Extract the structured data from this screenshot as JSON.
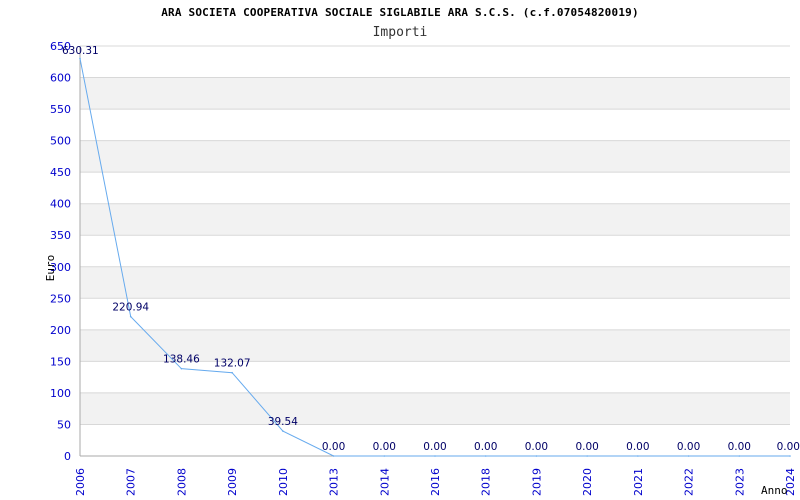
{
  "chart_data": {
    "type": "line",
    "title": "ARA SOCIETA COOPERATIVA SOCIALE SIGLABILE ARA S.C.S. (c.f.07054820019)",
    "subtitle": "Importi",
    "xlabel": "Anno",
    "ylabel": "Euro",
    "categories": [
      "2006",
      "2007",
      "2008",
      "2009",
      "2010",
      "2013",
      "2014",
      "2016",
      "2018",
      "2019",
      "2020",
      "2021",
      "2022",
      "2023",
      "2024"
    ],
    "series": [
      {
        "values": [
          630.31,
          220.94,
          138.46,
          132.07,
          39.54,
          0,
          0,
          0,
          0,
          0,
          0,
          0,
          0,
          0,
          0
        ]
      }
    ],
    "data_labels": [
      "630.31",
      "220.94",
      "138.46",
      "132.07",
      "39.54",
      "0.00",
      "0.00",
      "0.00",
      "0.00",
      "0.00",
      "0.00",
      "0.00",
      "0.00",
      "0.00",
      "0.00"
    ],
    "y_ticks": [
      "0",
      "50",
      "100",
      "150",
      "200",
      "250",
      "300",
      "350",
      "400",
      "450",
      "500",
      "550",
      "600",
      "650"
    ],
    "ylim": [
      0,
      650
    ],
    "grid": true,
    "colors": {
      "line": "#66aaee",
      "band": "#f2f2f2",
      "grid": "#d8d8d8",
      "tick": "#0000cc",
      "data_label": "#000066"
    }
  }
}
